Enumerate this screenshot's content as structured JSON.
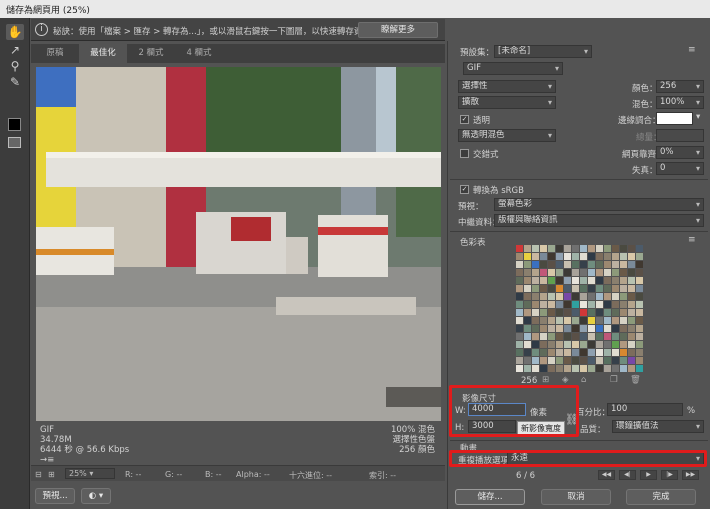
{
  "window": {
    "title": "儲存為網頁用 (25%)"
  },
  "tip": {
    "text": "秘訣：使用「檔案 > 匯存 > 轉存為...」，或以滑鼠右鍵按一下圖層，以快速轉存資產",
    "learn_more": "瞭解更多"
  },
  "tabs": [
    {
      "label": "原稿"
    },
    {
      "label": "最佳化"
    },
    {
      "label": "2 欄式"
    },
    {
      "label": "4 欄式"
    }
  ],
  "image_info": {
    "format": "GIF",
    "size": "34.78M",
    "time": "6444 秒 @ 56.6 Kbps",
    "arrow": "→≡",
    "dither": "100% 混色",
    "palette": "選擇性色盤",
    "colors": "256 顏色"
  },
  "status": {
    "zoom": "25%",
    "r": "R: --",
    "g": "G: --",
    "b": "B: --",
    "alpha": "Alpha: --",
    "hex": "十六進位: --",
    "index": "索引: --"
  },
  "bottom": {
    "preview": "預視...",
    "save": "儲存...",
    "cancel": "取消",
    "done": "完成"
  },
  "settings": {
    "preset_label": "預設集：",
    "preset_value": "[未命名]",
    "format": "GIF",
    "reduction": "選擇性",
    "dither_algo": "擴散",
    "colors_label": "顏色：",
    "colors_value": "256",
    "dither_label": "混色：",
    "dither_value": "100%",
    "transparency": "透明",
    "matte_label": "邊緣調合：",
    "trans_dither": "無透明混色",
    "amount_label": "總量：",
    "interlaced": "交錯式",
    "web_snap_label": "網頁靠齊：",
    "web_snap_value": "0%",
    "lossy_label": "失真：",
    "lossy_value": "0",
    "convert_srgb": "轉換為 sRGB",
    "preview_label": "預視：",
    "preview_value": "螢幕色彩",
    "metadata_label": "中繼資料：",
    "metadata_value": "版權與聯絡資訊"
  },
  "color_table": {
    "title": "色彩表",
    "count": "256",
    "colors": [
      "#8a7f6e",
      "#c9b8a0",
      "#5a5047",
      "#3c3a36",
      "#9fb3a8",
      "#6f8d7e",
      "#d6d2c4",
      "#b4a48c",
      "#7a8a99",
      "#4c5b6a",
      "#a9a39a",
      "#e1ddd2",
      "#5f6b5a",
      "#8c9a7a",
      "#b8c2b0",
      "#403830",
      "#c8c0b0",
      "#707070",
      "#2f3a46",
      "#9c8870",
      "#6a5a48",
      "#d8c8a8",
      "#8fa0b0",
      "#587060",
      "#a0b8c8",
      "#7c6c5c",
      "#bcb0a0",
      "#4a4a40",
      "#9aa890",
      "#e8e4dc",
      "#36404a",
      "#b09880"
    ],
    "extra_colors": [
      "#d03838",
      "#e8d040",
      "#3a70c0",
      "#c05878",
      "#60a050",
      "#d88830",
      "#7848a8",
      "#30a0a0"
    ]
  },
  "image_size": {
    "title": "影像尺寸",
    "w_label": "W:",
    "w_value": "4000",
    "h_label": "H:",
    "h_value": "3000",
    "unit": "像素",
    "percent_label": "百分比：",
    "percent_value": "100",
    "percent_unit": "%",
    "quality_label": "品質：",
    "quality_value": "環鐘擴值法",
    "tooltip": "新影像寬度"
  },
  "animation": {
    "title": "動畫",
    "loop_label": "重複播放選項：",
    "loop_value": "永遠",
    "frame": "6 / 6"
  },
  "highlight_color": "#e01c1c"
}
